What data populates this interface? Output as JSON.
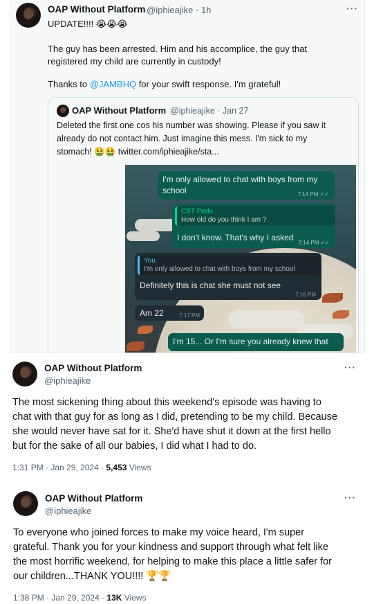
{
  "tweet1": {
    "author_name": "OAP Without Platform",
    "handle_time": "@iphieajike · 1h",
    "line1": "UPDATE!!!! 😭😭😭",
    "para1_l1": "The guy has been arrested. Him and his accomplice, the guy that",
    "para1_l2": "registered my child are currently in custody!",
    "thanks_pre": "Thanks to ",
    "thanks_link": "@JAMBHQ",
    "thanks_post": " for your swift response. I'm grateful!",
    "more_icon": "more-dots-icon",
    "quote": {
      "author_name": "OAP Without Platform",
      "handle_date": "@iphieajike · Jan 27",
      "l1": "Deleted the first one cos his number was showing. Please if you saw it",
      "l2": "already do not contact him. Just imagine this mess. I'm sick to my",
      "l3": "stomach! 🤮🤮  twitter.com/iphieajike/sta...",
      "chat": {
        "m1_text_a": "I'm only allowed to chat with boys from my",
        "m1_text_b": "school",
        "m1_time": "7:14 PM ✓✓",
        "m2_quote_name": "CBT Pedo",
        "m2_quote_text": "How old do you think I am ?",
        "m2_text": "I don't know. That's why I asked",
        "m2_time": "7:14 PM ✓✓",
        "m3_quote_name": "You",
        "m3_quote_text": "I'm only allowed to chat with boys from my school",
        "m3_text": "Definitely this is chat she must not see",
        "m3_time": "7:16 PM",
        "m4_text": "Am 22",
        "m4_time": "7:17 PM",
        "m5_text": "I'm 15... Or I'm sure you already knew that"
      }
    }
  },
  "tweet2": {
    "author_name": "OAP Without Platform",
    "handle": "@iphieajike",
    "l1": "The most sickening thing about this weekend's episode was having to",
    "l2": "chat with that guy for as long as I did, pretending to be my child. Because",
    "l3": "she would never have sat for it. She'd have shut it down at the first hello",
    "l4": "but for the sake of all our babies, I did what I had to do.",
    "time": "1:31 PM · Jan 29, 2024 · ",
    "views_count": "5,453",
    "views_label": " Views"
  },
  "tweet3": {
    "author_name": "OAP Without Platform",
    "handle": "@iphieajike",
    "l1": "To everyone who joined forces to make my voice heard, I'm super",
    "l2": "grateful. Thank you for your kindness and support through what felt like",
    "l3": "the most horrific weekend, for helping to make this place a little safer for",
    "l4": "our children...THANK YOU!!!! 🏆🏆",
    "time": "1:38 PM · Jan 29, 2024 · ",
    "views_count": "13K",
    "views_label": " Views"
  },
  "more_glyph": "···"
}
